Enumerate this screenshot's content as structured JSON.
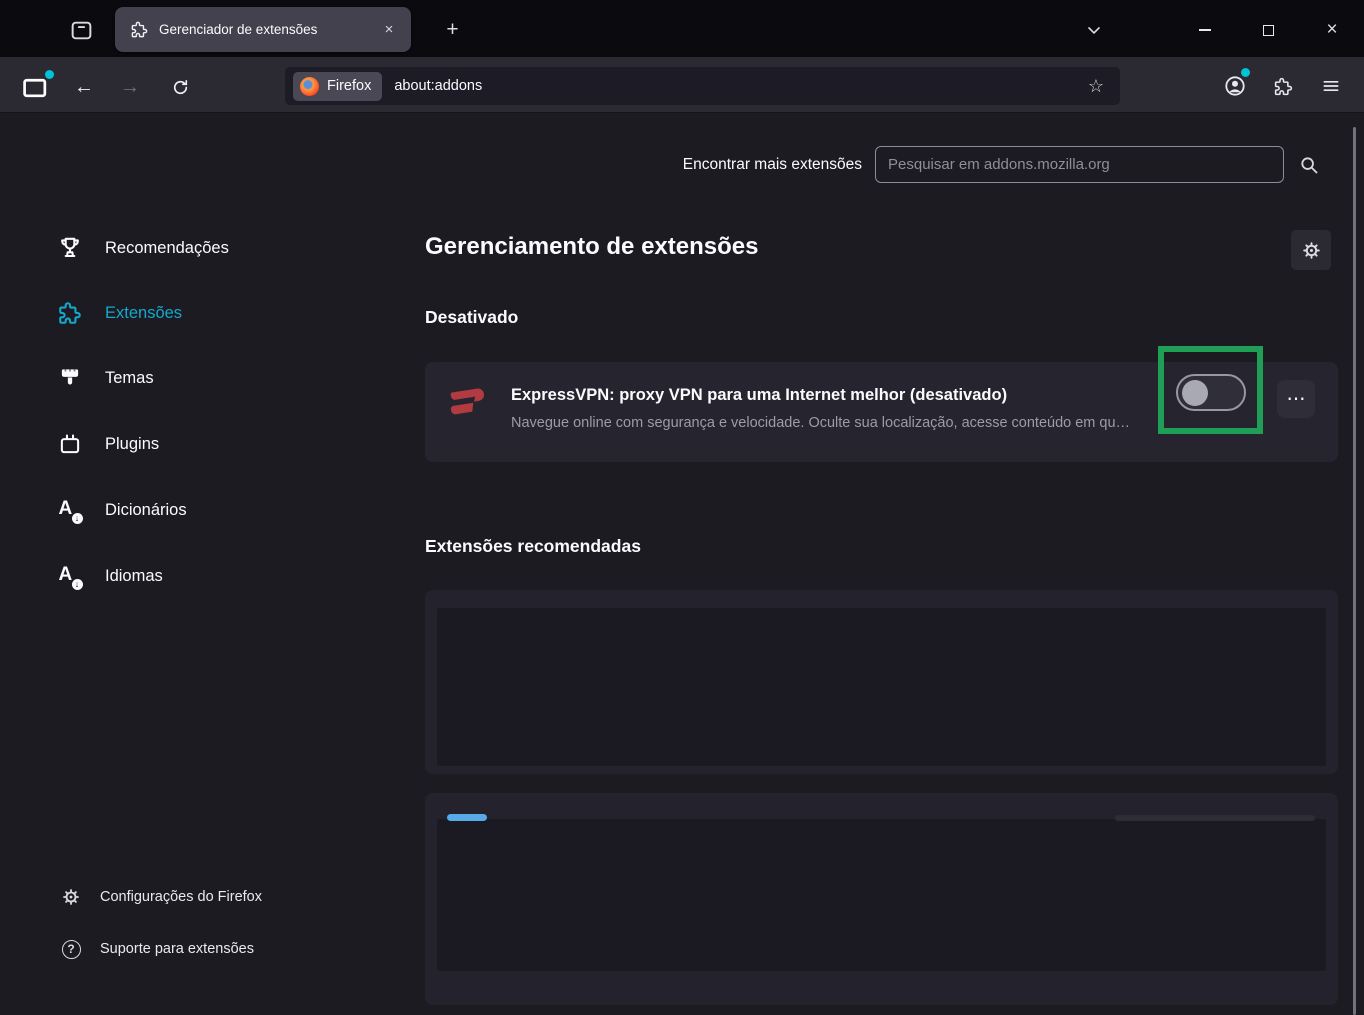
{
  "titlebar": {
    "tab_title": "Gerenciador de extensões",
    "glyphs": {
      "close_tab": "×",
      "new_tab": "+",
      "close_window": "×"
    }
  },
  "toolbar": {
    "url_chip_label": "Firefox",
    "url": "about:addons",
    "glyphs": {
      "back": "←",
      "forward": "→",
      "star": "☆"
    }
  },
  "find_bar": {
    "label": "Encontrar mais extensões",
    "search_placeholder": "Pesquisar em addons.mozilla.org"
  },
  "sidebar": {
    "items": [
      {
        "label": "Recomendações",
        "icon": "trophy-icon"
      },
      {
        "label": "Extensões",
        "icon": "puzzle-icon",
        "active": true
      },
      {
        "label": "Temas",
        "icon": "paintbrush-icon"
      },
      {
        "label": "Plugins",
        "icon": "plug-icon"
      },
      {
        "label": "Dicionários",
        "icon": "letter-a-download-icon"
      },
      {
        "label": "Idiomas",
        "icon": "letter-a-download-icon"
      }
    ],
    "footer_items": [
      {
        "label": "Configurações do Firefox",
        "icon": "gear-icon"
      },
      {
        "label": "Suporte para extensões",
        "icon": "question-icon"
      }
    ]
  },
  "main": {
    "title": "Gerenciamento de extensões",
    "sections": {
      "disabled": "Desativado",
      "recommended": "Extensões recomendadas"
    },
    "extension": {
      "name": "ExpressVPN: proxy VPN para uma Internet melhor (desativado)",
      "description": "Navegue online com segurança e velocidade. Oculte sua localização, acesse conteúdo em qu…",
      "enabled": false,
      "more_glyph": "⋯"
    }
  },
  "colors": {
    "accent_cyan": "#15a8cd",
    "highlight_green": "#1f9e55",
    "expressvpn_red": "#b23a41",
    "notification_teal": "#00c3d6"
  }
}
